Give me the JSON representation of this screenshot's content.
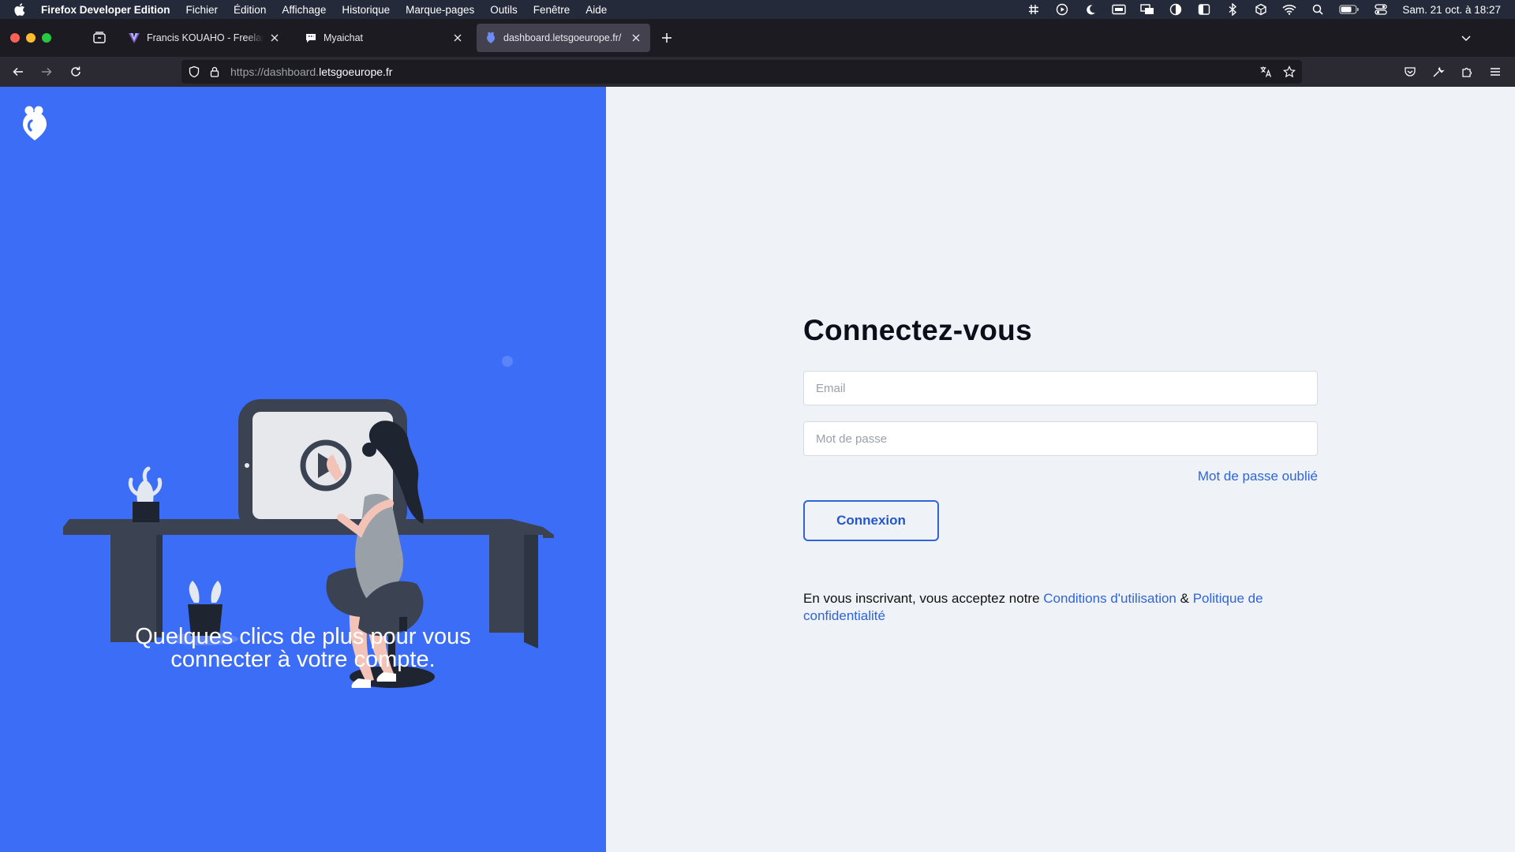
{
  "menubar": {
    "app_name": "Firefox Developer Edition",
    "items": [
      "Fichier",
      "Édition",
      "Affichage",
      "Historique",
      "Marque-pages",
      "Outils",
      "Fenêtre",
      "Aide"
    ],
    "clock": "Sam. 21 oct. à 18:27"
  },
  "tabs": [
    {
      "title": "Francis KOUAHO - Freelance dév",
      "icon": "vuetify-favicon-icon"
    },
    {
      "title": "Myaichat",
      "icon": "chat-favicon-icon"
    },
    {
      "title": "dashboard.letsgoeurope.fr/",
      "icon": "letsgoeurope-favicon-icon"
    }
  ],
  "urlbar": {
    "url_prefix": "https://dashboard.",
    "url_domain": "letsgoeurope.fr"
  },
  "left": {
    "tagline_line1": "Quelques clics de plus pour vous",
    "tagline_line2": "connecter à votre compte."
  },
  "form": {
    "heading": "Connectez-vous",
    "email_placeholder": "Email",
    "password_placeholder": "Mot de passe",
    "forgot_label": "Mot de passe oublié",
    "submit_label": "Connexion",
    "terms_prefix": "En vous inscrivant, vous acceptez notre ",
    "terms_link": "Conditions d'utilisation",
    "terms_amp": " & ",
    "privacy_link": "Politique de confidentialité"
  },
  "colors": {
    "brand_blue": "#3c6df6",
    "link_blue": "#2f64da",
    "page_bg": "#eff2f6"
  }
}
